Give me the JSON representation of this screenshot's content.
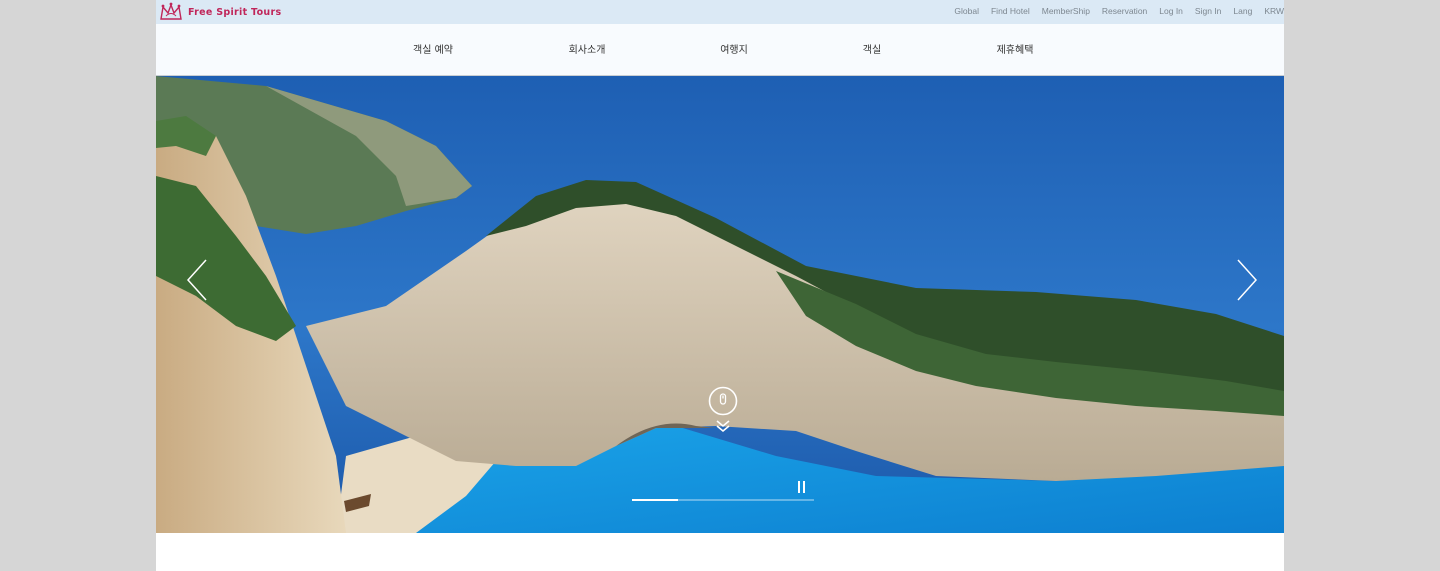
{
  "brand": {
    "name": "Free Spirit Tours",
    "color": "#c0265a"
  },
  "utility_nav": [
    {
      "label": "Global"
    },
    {
      "label": "Find Hotel"
    },
    {
      "label": "MemberShip"
    },
    {
      "label": "Reservation"
    },
    {
      "label": "Log In"
    },
    {
      "label": "Sign In"
    },
    {
      "label": "Lang"
    },
    {
      "label": "KRW"
    }
  ],
  "main_nav": [
    {
      "label": "객실 예약"
    },
    {
      "label": "회사소개"
    },
    {
      "label": "여행지"
    },
    {
      "label": "객실"
    },
    {
      "label": "제휴혜택"
    }
  ],
  "hero": {
    "prev_icon": "chevron-left-icon",
    "next_icon": "chevron-right-icon",
    "scroll_icon": "mouse-scroll-icon",
    "pause_icon": "pause-icon",
    "progress": 0.25
  }
}
